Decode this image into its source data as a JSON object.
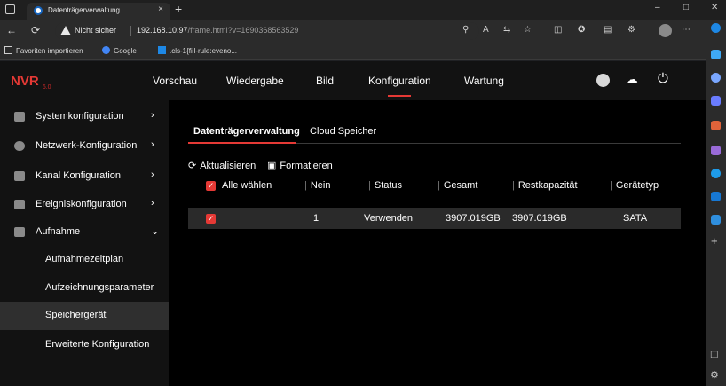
{
  "browser": {
    "tab_title": "Datenträgerverwaltung",
    "tab_close": "×",
    "new_tab": "+",
    "security_label": "Nicht sicher",
    "url_host": "192.168.10.97",
    "url_path": "/frame.html?v=1690368563529",
    "favorites": [
      "Favoriten importieren",
      "Google",
      ".cls-1{fill-rule:eveno..."
    ]
  },
  "app": {
    "logo": "NVR",
    "logo_version": "6.0",
    "nav": [
      "Vorschau",
      "Wiedergabe",
      "Bild",
      "Konfiguration",
      "Wartung"
    ],
    "active_nav": "Konfiguration"
  },
  "sidebar": {
    "items": [
      {
        "label": "Systemkonfiguration",
        "icon": "system-icon",
        "expand": "›"
      },
      {
        "label": "Netzwerk-Konfiguration",
        "icon": "network-icon",
        "expand": "›"
      },
      {
        "label": "Kanal Konfiguration",
        "icon": "camera-icon",
        "expand": "›"
      },
      {
        "label": "Ereigniskonfiguration",
        "icon": "event-icon",
        "expand": "›"
      },
      {
        "label": "Aufnahme",
        "icon": "record-icon",
        "expand": "⌄"
      }
    ],
    "subitems": [
      {
        "label": "Aufnahmezeitplan"
      },
      {
        "label": "Aufzeichnungsparameter"
      },
      {
        "label": "Speichergerät",
        "active": true
      },
      {
        "label": "Erweiterte Konfiguration"
      }
    ]
  },
  "content": {
    "tabs": [
      "Datenträgerverwaltung",
      "Cloud Speicher"
    ],
    "toolbar": {
      "refresh": "Aktualisieren",
      "format": "Formatieren"
    },
    "table": {
      "select_all": "Alle wählen",
      "columns": [
        "Nein",
        "Status",
        "Gesamt",
        "Restkapazität",
        "Gerätetyp"
      ],
      "rows": [
        {
          "nein": "1",
          "status": "Verwenden",
          "gesamt": "3907.019GB",
          "rest": "3907.019GB",
          "typ": "SATA",
          "checked": true
        }
      ]
    }
  },
  "colors": {
    "accent": "#e53935",
    "background": "#000000",
    "panel": "#121212"
  }
}
